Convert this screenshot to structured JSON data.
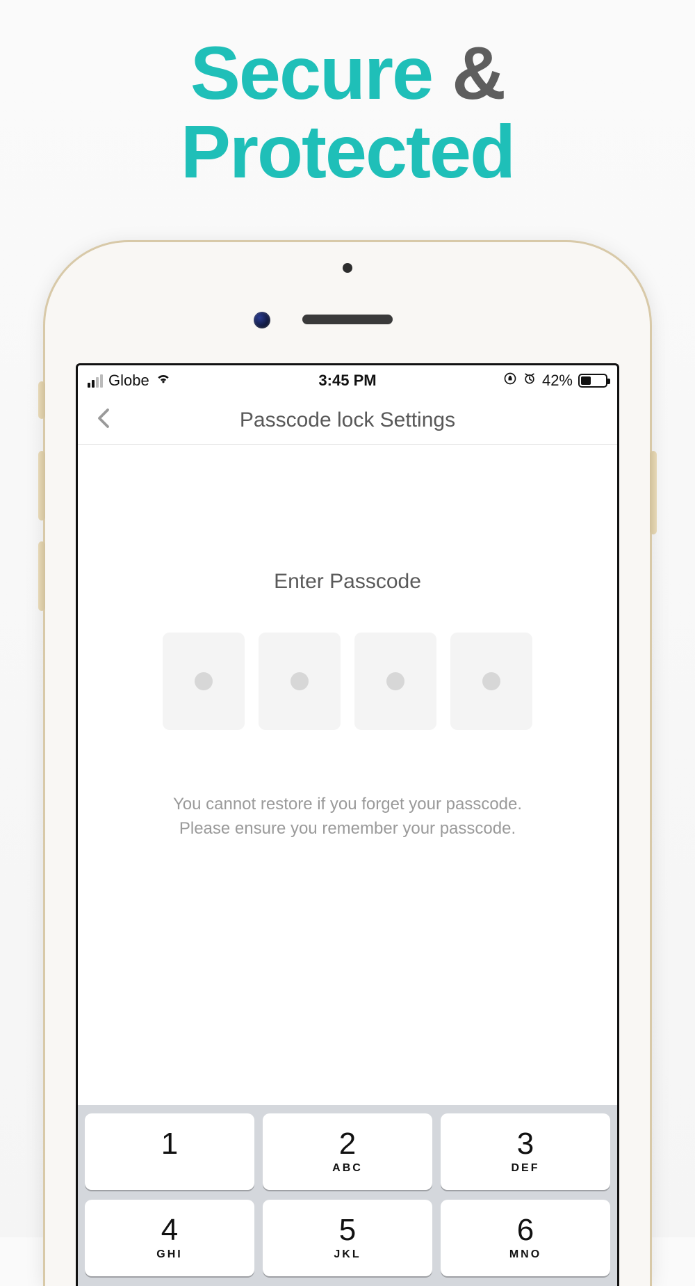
{
  "headline": {
    "word1": "Secure",
    "amp": "&",
    "word2": "Protected"
  },
  "status": {
    "carrier": "Globe",
    "time": "3:45 PM",
    "battery_text": "42%",
    "battery_pct": 42
  },
  "nav": {
    "title": "Passcode lock Settings"
  },
  "passcode": {
    "prompt": "Enter Passcode",
    "warning_line1": "You cannot restore if you forget your passcode.",
    "warning_line2": "Please ensure you remember your passcode."
  },
  "keypad": {
    "keys": [
      {
        "num": "1",
        "letters": ""
      },
      {
        "num": "2",
        "letters": "ABC"
      },
      {
        "num": "3",
        "letters": "DEF"
      },
      {
        "num": "4",
        "letters": "GHI"
      },
      {
        "num": "5",
        "letters": "JKL"
      },
      {
        "num": "6",
        "letters": "MNO"
      }
    ]
  }
}
